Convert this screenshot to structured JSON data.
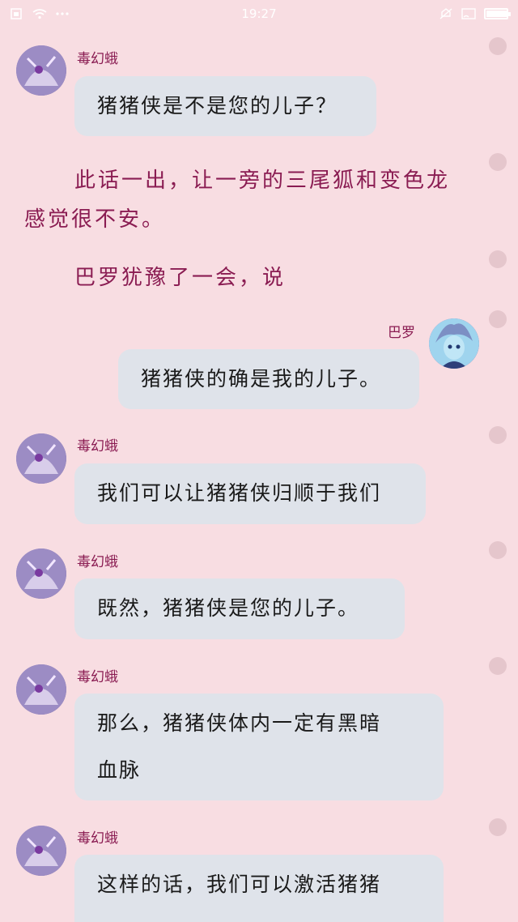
{
  "status_bar": {
    "time": "19:27",
    "battery_level": 0.95,
    "icons": [
      "sim-icon",
      "wifi-icon",
      "more-dots-icon",
      "mute-icon",
      "cast-icon",
      "battery-icon"
    ]
  },
  "colors": {
    "background": "#f8dde2",
    "bubble": "#dfe3ea",
    "name_text": "#8a1c52",
    "narration_text": "#8a1c52"
  },
  "messages": [
    {
      "sender": "毒幻蛾",
      "text": "猪猪侠是不是您的儿子？"
    },
    {
      "sender": "巴罗",
      "text": "猪猪侠的确是我的儿子。"
    },
    {
      "sender": "毒幻蛾",
      "text": "我们可以让猪猪侠归顺于我们"
    },
    {
      "sender": "毒幻蛾",
      "text": "既然，猪猪侠是您的儿子。"
    },
    {
      "sender": "毒幻蛾",
      "text_line1": "那么，猪猪侠体内一定有黑暗",
      "text_line2": "血脉"
    },
    {
      "sender": "毒幻蛾",
      "text_line1": "这样的话，我们可以激活猪猪"
    }
  ],
  "narration": {
    "n1_line1": "此话一出，让一旁的三尾狐和变色龙",
    "n1_line2": "感觉很不安。",
    "n2": "巴罗犹豫了一会，说"
  }
}
